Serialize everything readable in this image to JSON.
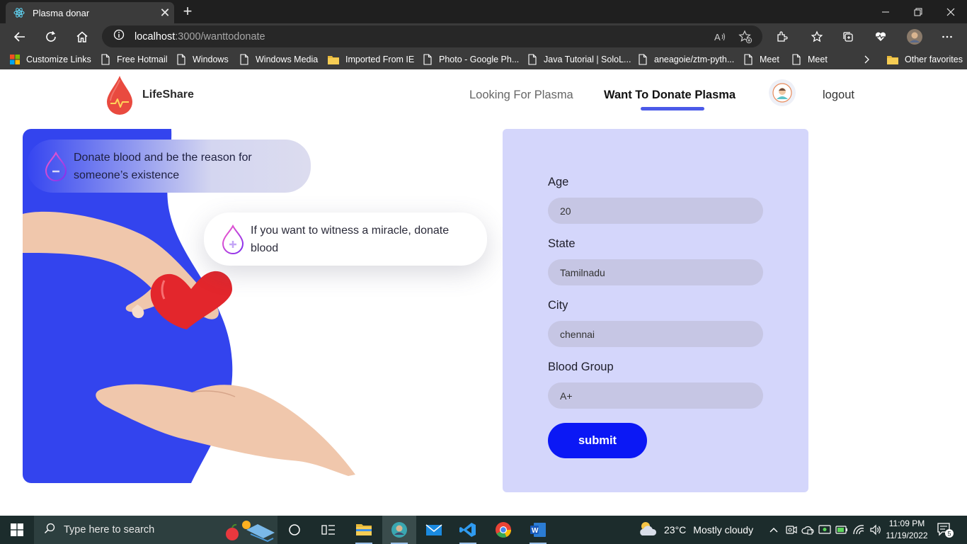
{
  "browser": {
    "tab_title": "Plasma donar",
    "url_host": "localhost",
    "url_path": ":3000/wanttodonate"
  },
  "favorites": [
    {
      "label": "Customize Links",
      "icon": "windows-logo-icon"
    },
    {
      "label": "Free Hotmail",
      "icon": "page-icon"
    },
    {
      "label": "Windows",
      "icon": "page-icon"
    },
    {
      "label": "Windows Media",
      "icon": "page-icon"
    },
    {
      "label": "Imported From IE",
      "icon": "folder-icon"
    },
    {
      "label": "Photo - Google Ph...",
      "icon": "page-icon"
    },
    {
      "label": "Java Tutorial | SoloL...",
      "icon": "page-icon"
    },
    {
      "label": "aneagoie/ztm-pyth...",
      "icon": "page-icon"
    },
    {
      "label": "Meet",
      "icon": "page-icon"
    },
    {
      "label": "Meet",
      "icon": "page-icon"
    },
    {
      "label": "Other favorites",
      "icon": "folder-icon"
    }
  ],
  "nav": {
    "brand": "LifeShare",
    "looking": "Looking For Plasma",
    "donate": "Want To Donate Plasma",
    "logout": "logout"
  },
  "hero": {
    "badge1": "Donate blood and be the reason for someone’s existence",
    "badge2": "If you want to witness a miracle, donate blood"
  },
  "form": {
    "age_label": "Age",
    "age_value": "20",
    "state_label": "State",
    "state_value": "Tamilnadu",
    "city_label": "City",
    "city_value": "chennai",
    "blood_label": "Blood Group",
    "blood_value": "A+",
    "submit_label": "submit"
  },
  "taskbar": {
    "search_placeholder": "Type here to search",
    "weather_temp": "23°C",
    "weather_desc": "Mostly cloudy",
    "time": "11:09 PM",
    "date": "11/19/2022",
    "notification_count": "5"
  },
  "colors": {
    "accent_blue": "#3344ee",
    "form_bg": "#d4d6fb",
    "submit_bg": "#0b18f5",
    "logo_red": "#e94a3f"
  }
}
